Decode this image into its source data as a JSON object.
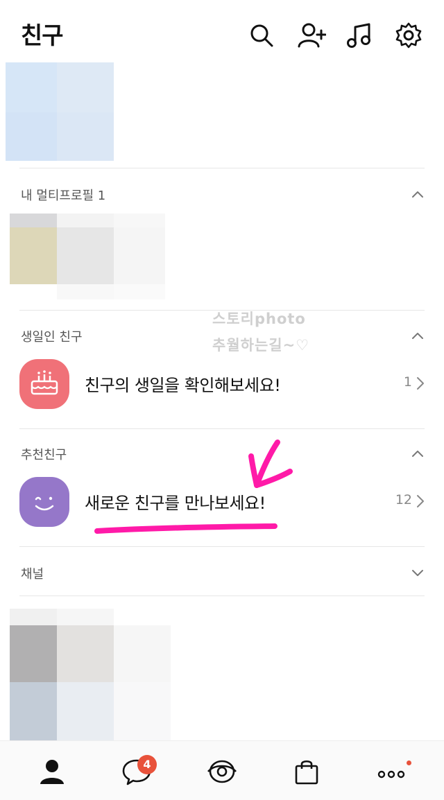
{
  "header": {
    "title": "친구",
    "icons": [
      "search-icon",
      "add-friend-icon",
      "music-icon",
      "settings-icon"
    ]
  },
  "sections": {
    "multi_profile": {
      "label": "내 멀티프로필 1",
      "chevron": "chevron-up-icon"
    },
    "birthday": {
      "label": "생일인 친구",
      "chevron": "chevron-up-icon",
      "row_text": "친구의 생일을 확인해보세요!",
      "count": "1",
      "icon": "cake-icon",
      "icon_color": "#f07178"
    },
    "recommended": {
      "label": "추천친구",
      "chevron": "chevron-up-icon",
      "row_text": "새로운 친구를 만나보세요!",
      "count": "12",
      "icon": "smile-face-icon",
      "icon_color": "#9577c9"
    },
    "channel": {
      "label": "채널",
      "chevron": "chevron-down-icon"
    }
  },
  "watermark": {
    "line1": "스토리photo",
    "line2": "추월하는길~♡"
  },
  "annotation": {
    "color": "#ff1aa8"
  },
  "bottom_nav": {
    "tabs": [
      "friends-tab-icon",
      "chats-tab-icon",
      "view-tab-icon",
      "shopping-tab-icon",
      "more-tab-icon"
    ],
    "chat_badge": "4",
    "accent": "#e8523b"
  }
}
